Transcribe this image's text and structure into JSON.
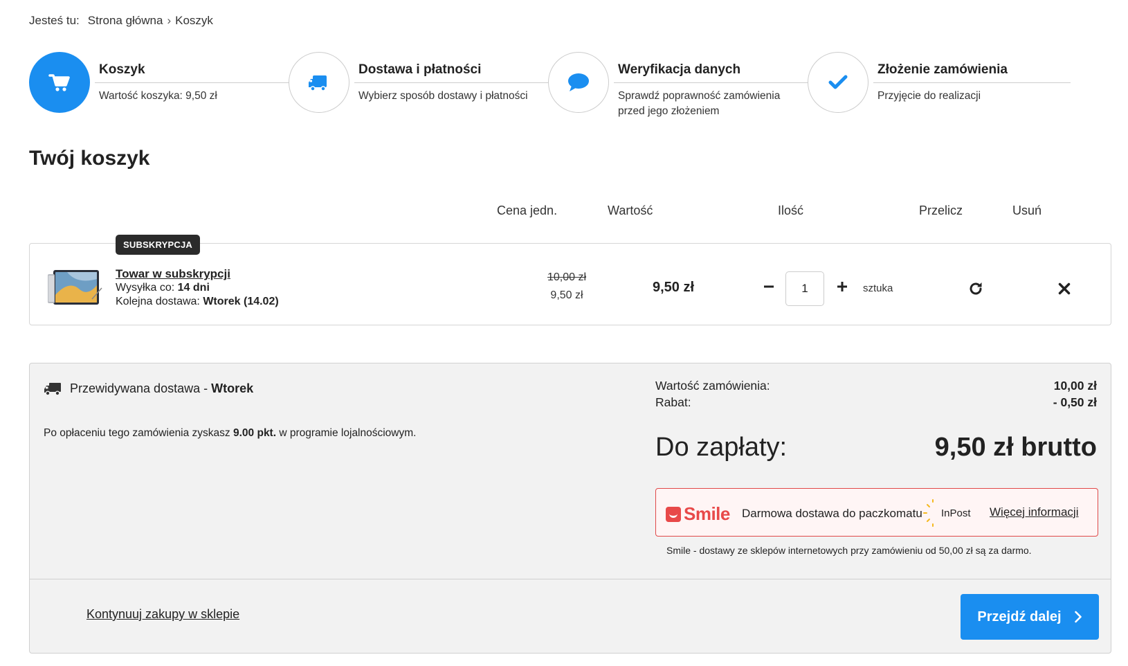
{
  "breadcrumb": {
    "lead": "Jesteś tu:",
    "home": "Strona główna",
    "current": "Koszyk"
  },
  "steps": [
    {
      "title": "Koszyk",
      "desc": "Wartość koszyka: 9,50 zł",
      "icon": "cart-icon",
      "active": true
    },
    {
      "title": "Dostawa i płatności",
      "desc": "Wybierz sposób dostawy i płatności",
      "icon": "truck-icon",
      "active": false
    },
    {
      "title": "Weryfikacja danych",
      "desc": "Sprawdź poprawność zamówienia przed jego złożeniem",
      "icon": "speech-bubble-icon",
      "active": false
    },
    {
      "title": "Złożenie zamówienia",
      "desc": "Przyjęcie do realizacji",
      "icon": "checkmark-icon",
      "active": false
    }
  ],
  "page_title": "Twój koszyk",
  "columns": {
    "unit_price": "Cena jedn.",
    "value": "Wartość",
    "quantity": "Ilość",
    "recalc": "Przelicz",
    "remove": "Usuń"
  },
  "cart_item": {
    "badge": "SUBSKRYPCJA",
    "name": "Towar w subskrypcji",
    "shipping_label": "Wysyłka co:",
    "shipping_value": "14 dni",
    "next_label": "Kolejna dostawa:",
    "next_value": "Wtorek (14.02)",
    "price_old": "10,00 zł",
    "price_new": "9,50 zł",
    "value": "9,50 zł",
    "quantity": "1",
    "unit": "sztuka"
  },
  "summary": {
    "delivery_label": "Przewidywana dostawa -",
    "delivery_day": "Wtorek",
    "loyalty_pre": "Po opłaceniu tego zamówienia zyskasz",
    "loyalty_points": "9.00 pkt.",
    "loyalty_post": "w programie lojalnościowym.",
    "order_value_label": "Wartość zamówienia:",
    "order_value": "10,00 zł",
    "discount_label": "Rabat:",
    "discount": "- 0,50 zł",
    "to_pay_label": "Do zapłaty:",
    "to_pay": "9,50 zł brutto",
    "smile_logo": "Smile",
    "smile_desc": "Darmowa dostawa do paczkomatu",
    "inpost": "InPost",
    "smile_more": "Więcej informacji",
    "smile_note": "Smile - dostawy ze sklepów internetowych przy zamówieniu od 50,00 zł są za darmo.",
    "continue": "Kontynuuj zakupy w sklepie",
    "next": "Przejdź dalej"
  },
  "colors": {
    "accent": "#1a8ef0",
    "smile": "#e84949"
  }
}
